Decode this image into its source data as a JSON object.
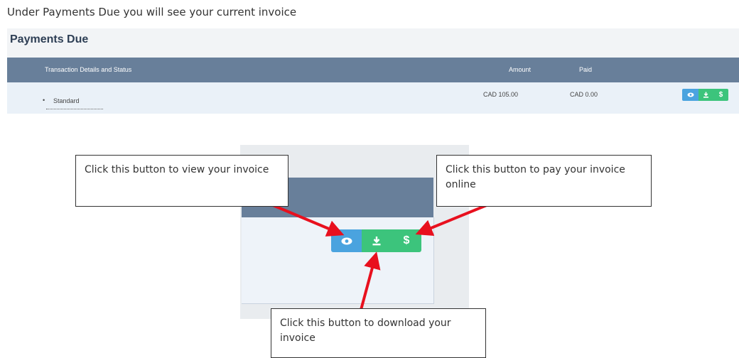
{
  "intro_text": "Under Payments Due you will see your current invoice",
  "panel": {
    "title": "Payments Due",
    "columns": [
      "Transaction Details and Status",
      "Amount",
      "Paid"
    ],
    "row": {
      "item": "Standard",
      "amount": "CAD 105.00",
      "paid": "CAD 0.00"
    }
  },
  "buttons": {
    "view": {
      "icon": "eye-icon",
      "color": "#4aa3df"
    },
    "download": {
      "icon": "download-icon",
      "color": "#3cc47c"
    },
    "pay": {
      "icon": "dollar-icon",
      "label": "$",
      "color": "#3cc47c"
    }
  },
  "callouts": {
    "view": "Click this button to view your invoice",
    "pay": "Click this button to pay your invoice online",
    "download": "Click this button to download your invoice"
  },
  "colors": {
    "header": "#687f9a",
    "row_bg": "#eaf1f8",
    "arrow": "#e8101e"
  }
}
